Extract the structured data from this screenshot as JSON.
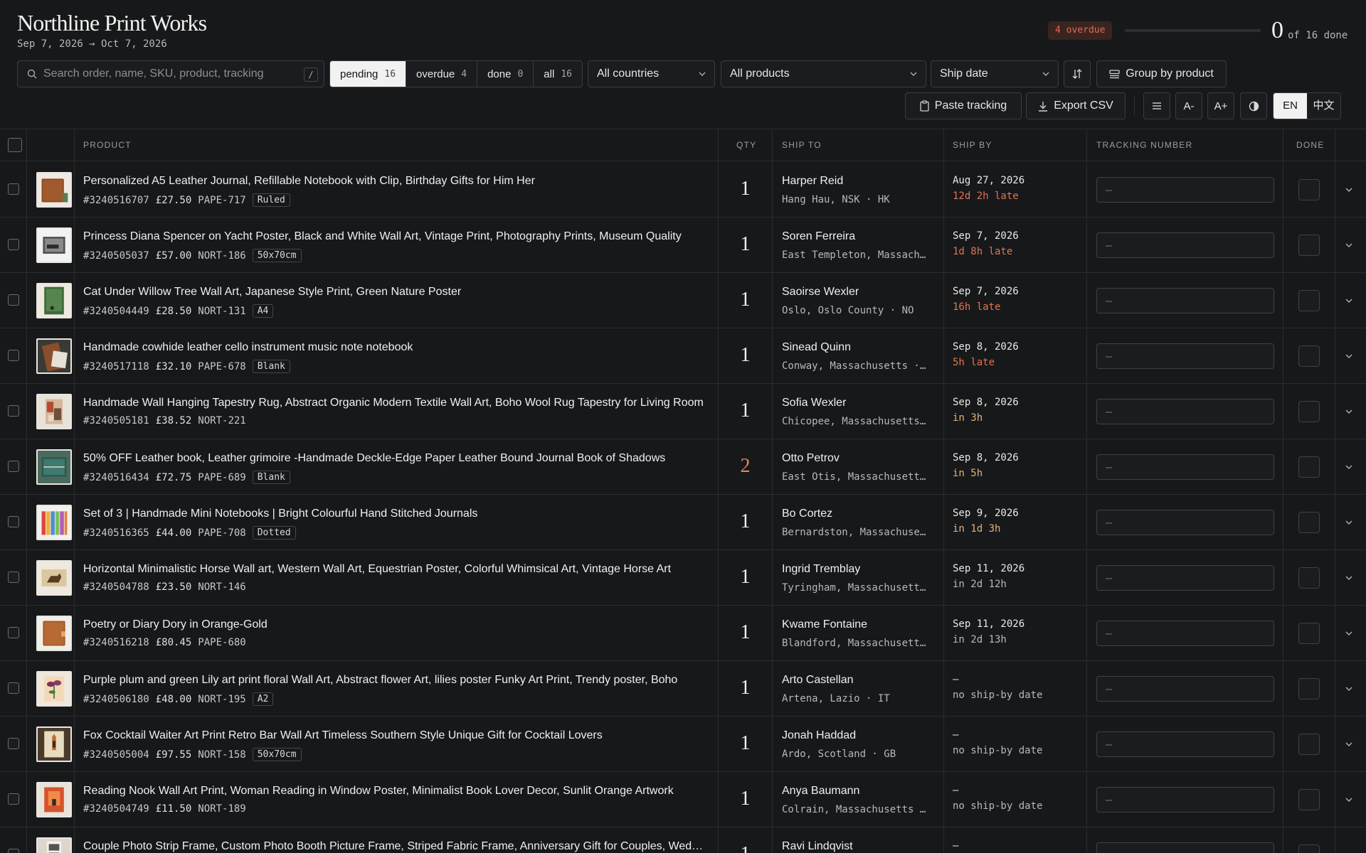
{
  "header": {
    "brand": "Northline Print Works",
    "date_range": "Sep 7, 2026 → Oct 7, 2026",
    "overdue_badge": "4 overdue",
    "done_count": "0",
    "done_of": "of 16 done",
    "progress_fraction": 0
  },
  "toolbar": {
    "search_placeholder": "Search order, name, SKU, product, tracking",
    "search_shortcut": "/",
    "filters": [
      {
        "label": "pending",
        "count": "16",
        "active": true
      },
      {
        "label": "overdue",
        "count": "4",
        "active": false
      },
      {
        "label": "done",
        "count": "0",
        "active": false
      },
      {
        "label": "all",
        "count": "16",
        "active": false
      }
    ],
    "country_select": "All countries",
    "product_select": "All products",
    "sort_select": "Ship date",
    "group_button": "Group by product",
    "paste_tracking": "Paste tracking",
    "export_csv": "Export CSV",
    "font_smaller": "A-",
    "font_larger": "A+",
    "lang_en": "EN",
    "lang_zh": "中文",
    "active_lang": "EN"
  },
  "table": {
    "headers": {
      "product": "PRODUCT",
      "qty": "QTY",
      "ship_to": "SHIP TO",
      "ship_by": "SHIP BY",
      "tracking": "TRACKING NUMBER",
      "done": "DONE"
    },
    "tracking_placeholder": "–",
    "rows": [
      {
        "title": "Personalized A5 Leather Journal, Refillable Notebook with Clip, Birthday Gifts for Him Her",
        "order": "#3240516707",
        "price": "£27.50",
        "sku": "PAPE-717",
        "variant": "Ruled",
        "qty": "1",
        "name": "Harper Reid",
        "location": "Hang Hau, NSK · HK",
        "ship_by": "Aug 27, 2026",
        "status": "12d 2h late",
        "status_kind": "late",
        "thumb": "journal-brown"
      },
      {
        "title": "Princess Diana Spencer on Yacht Poster, Black and White Wall Art, Vintage Print, Photography Prints, Museum Quality",
        "order": "#3240505037",
        "price": "£57.00",
        "sku": "NORT-186",
        "variant": "50x70cm",
        "qty": "1",
        "name": "Soren Ferreira",
        "location": "East Templeton, Massachusetts · US",
        "ship_by": "Sep 7, 2026",
        "status": "1d 8h late",
        "status_kind": "late",
        "thumb": "poster-bw"
      },
      {
        "title": "Cat Under Willow Tree Wall Art, Japanese Style Print, Green Nature Poster",
        "order": "#3240504449",
        "price": "£28.50",
        "sku": "NORT-131",
        "variant": "A4",
        "qty": "1",
        "name": "Saoirse Wexler",
        "location": "Oslo, Oslo County · NO",
        "ship_by": "Sep 7, 2026",
        "status": "16h late",
        "status_kind": "late",
        "thumb": "willow-green"
      },
      {
        "title": "Handmade cowhide leather cello instrument music note notebook",
        "order": "#3240517118",
        "price": "£32.10",
        "sku": "PAPE-678",
        "variant": "Blank",
        "qty": "1",
        "name": "Sinead Quinn",
        "location": "Conway, Massachusetts · US",
        "ship_by": "Sep 8, 2026",
        "status": "5h late",
        "status_kind": "late",
        "thumb": "cello-notebook"
      },
      {
        "title": "Handmade Wall Hanging Tapestry Rug, Abstract Organic Modern Textile Wall Art, Boho Wool Rug Tapestry for Living Room",
        "order": "#3240505181",
        "price": "£38.52",
        "sku": "NORT-221",
        "variant": "",
        "qty": "1",
        "name": "Sofia Wexler",
        "location": "Chicopee, Massachusetts · US",
        "ship_by": "Sep 8, 2026",
        "status": "in 3h",
        "status_kind": "soon",
        "thumb": "tapestry"
      },
      {
        "title": "50% OFF Leather book, Leather grimoire -Handmade Deckle-Edge Paper Leather Bound Journal Book of Shadows",
        "order": "#3240516434",
        "price": "£72.75",
        "sku": "PAPE-689",
        "variant": "Blank",
        "qty": "2",
        "name": "Otto Petrov",
        "location": "East Otis, Massachusetts · US",
        "ship_by": "Sep 8, 2026",
        "status": "in 5h",
        "status_kind": "soon",
        "thumb": "grimoire-teal"
      },
      {
        "title": "Set of 3 | Handmade Mini Notebooks | Bright Colourful Hand Stitched Journals",
        "order": "#3240516365",
        "price": "£44.00",
        "sku": "PAPE-708",
        "variant": "Dotted",
        "qty": "1",
        "name": "Bo Cortez",
        "location": "Bernardston, Massachusetts · US",
        "ship_by": "Sep 9, 2026",
        "status": "in 1d 3h",
        "status_kind": "soon",
        "thumb": "mini-notebooks"
      },
      {
        "title": "Horizontal Minimalistic Horse Wall art, Western Wall Art, Equestrian Poster, Colorful Whimsical Art, Vintage Horse Art",
        "order": "#3240504788",
        "price": "£23.50",
        "sku": "NORT-146",
        "variant": "",
        "qty": "1",
        "name": "Ingrid Tremblay",
        "location": "Tyringham, Massachusetts · US",
        "ship_by": "Sep 11, 2026",
        "status": "in 2d 12h",
        "status_kind": "later",
        "thumb": "horse-print"
      },
      {
        "title": "Poetry or Diary Dory in Orange-Gold",
        "order": "#3240516218",
        "price": "£80.45",
        "sku": "PAPE-680",
        "variant": "",
        "qty": "1",
        "name": "Kwame Fontaine",
        "location": "Blandford, Massachusetts · US",
        "ship_by": "Sep 11, 2026",
        "status": "in 2d 13h",
        "status_kind": "later",
        "thumb": "diary-orange"
      },
      {
        "title": "Purple plum and green Lily art print floral Wall Art, Abstract flower Art, lilies poster Funky Art Print, Trendy poster, Boho",
        "order": "#3240506180",
        "price": "£48.00",
        "sku": "NORT-195",
        "variant": "A2",
        "qty": "1",
        "name": "Arto Castellan",
        "location": "Artena, Lazio · IT",
        "ship_by": "–",
        "status": "no ship-by date",
        "status_kind": "nodate",
        "thumb": "lily-print"
      },
      {
        "title": "Fox Cocktail Waiter Art Print Retro Bar Wall Art Timeless Southern Style Unique Gift for Cocktail Lovers",
        "order": "#3240505004",
        "price": "£97.55",
        "sku": "NORT-158",
        "variant": "50x70cm",
        "qty": "1",
        "name": "Jonah Haddad",
        "location": "Ardo, Scotland · GB",
        "ship_by": "–",
        "status": "no ship-by date",
        "status_kind": "nodate",
        "thumb": "fox-print"
      },
      {
        "title": "Reading Nook Wall Art Print, Woman Reading in Window Poster, Minimalist Book Lover Decor, Sunlit Orange Artwork",
        "order": "#3240504749",
        "price": "£11.50",
        "sku": "NORT-189",
        "variant": "",
        "qty": "1",
        "name": "Anya Baumann",
        "location": "Colrain, Massachusetts · US",
        "ship_by": "–",
        "status": "no ship-by date",
        "status_kind": "nodate",
        "thumb": "reading-nook"
      },
      {
        "title": "Couple Photo Strip Frame, Custom Photo Booth Picture Frame, Striped Fabric Frame, Anniversary Gift for Couples, Wedding",
        "order": "",
        "price": "",
        "sku": "",
        "variant": "",
        "qty": "1",
        "name": "Ravi Lindqvist",
        "location": "",
        "ship_by": "–",
        "status": "",
        "status_kind": "nodate",
        "thumb": "photo-strip"
      }
    ]
  }
}
